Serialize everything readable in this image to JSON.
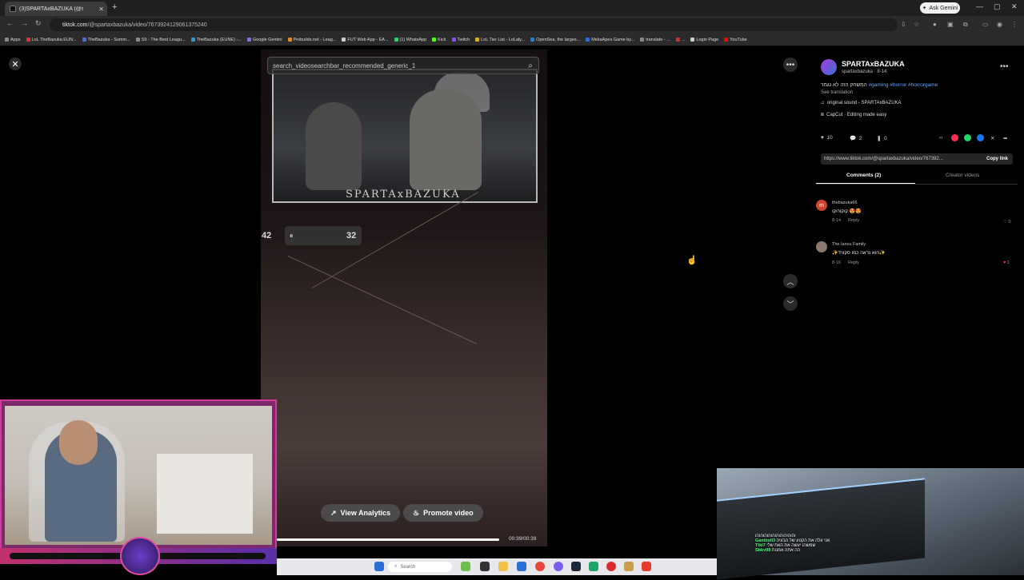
{
  "browser": {
    "tab_title": "(3)SPARTAxBAZUKA (@spa...",
    "new_tab": "+",
    "gemini_label": "Ask Gemini",
    "url_host": "tiktok.com",
    "url_path": "/@spartaxbazuka/video/7673924129061375240",
    "bookmarks": [
      {
        "label": "Apps",
        "color": "#888"
      },
      {
        "label": "LoL TheBazuka EUN...",
        "color": "#d33"
      },
      {
        "label": "TheBazuka - Summ...",
        "color": "#4a6cd4"
      },
      {
        "label": "S9 - The Best Leagu...",
        "color": "#888"
      },
      {
        "label": "TheBazuka (EUNE) -...",
        "color": "#2b9ad8"
      },
      {
        "label": "Google Gemini",
        "color": "#8a6cf0"
      },
      {
        "label": "Probuilds.net - Leag...",
        "color": "#e08a2b"
      },
      {
        "label": "FUT Web App - EA...",
        "color": "#ccc"
      },
      {
        "label": "(1) WhatsApp",
        "color": "#25d366"
      },
      {
        "label": "Kick",
        "color": "#53fc18"
      },
      {
        "label": "Twitch",
        "color": "#9146ff"
      },
      {
        "label": "LoL Tier List - LoLaly...",
        "color": "#d8b02b"
      },
      {
        "label": "OpenSea, the larges...",
        "color": "#2081e2"
      },
      {
        "label": "MekaApes Game by...",
        "color": "#2b6ad8"
      },
      {
        "label": "translate - ...",
        "color": "#888"
      },
      {
        "label": "...",
        "color": "#c33"
      },
      {
        "label": "Login Page",
        "color": "#ccc"
      },
      {
        "label": "YouTube",
        "color": "#f00"
      }
    ]
  },
  "video": {
    "search_placeholder": "search_videosearchbar_recommended_generic_1",
    "brand_text": "SPARTAxBAZUKA",
    "score_left": "42",
    "score_right": "32",
    "pause_icon": "⏸",
    "view_analytics": "View Analytics",
    "promote_video": "Promote video",
    "timecode": "00:39/00:39",
    "progress": 1.0
  },
  "panel": {
    "author_name": "SPARTAxBAZUKA",
    "author_handle": "spartaxbazuka · 8-14",
    "description": "המשחק הזה לא נגמר",
    "tags": "#gaming #horror #horrorgame",
    "see_translation": "See translation",
    "sound": "original sound - SPARTAxBAZUKA",
    "capcut": "CapCut · Editing made easy",
    "likes": "10",
    "comments_count": "2",
    "saves": "0",
    "link": "https://www.tiktok.com/@spartaxbazuka/video/767392...",
    "copy_link": "Copy link",
    "tab_comments": "Comments (2)",
    "tab_creator": "Creator videos",
    "comments": [
      {
        "user": "thebazuka66",
        "text": "קוקורוקו 😍😍",
        "date": "8-14",
        "reply": "Reply",
        "likes": "0",
        "avatar_color": "#d0452e"
      },
      {
        "user": "The Iancu Family",
        "text": "✨הוא נראה כמו סקוויד✨",
        "date": "8-16",
        "reply": "Reply",
        "likes": "1",
        "avatar_color": "#8a7a70"
      }
    ]
  },
  "stream_chat": [
    {
      "user": "",
      "text": "והוהוהוהוהוהוהוהוהוהו"
    },
    {
      "user": "Gamboll3",
      "text": "אני עלה את הקטע של הבעיה"
    },
    {
      "user": "Ttki7",
      "text": "שמשהו יעשה את האח שלי"
    },
    {
      "user": "Sbkv98",
      "text": "הה אתה אמנות"
    }
  ],
  "taskbar": {
    "search": "Search"
  }
}
